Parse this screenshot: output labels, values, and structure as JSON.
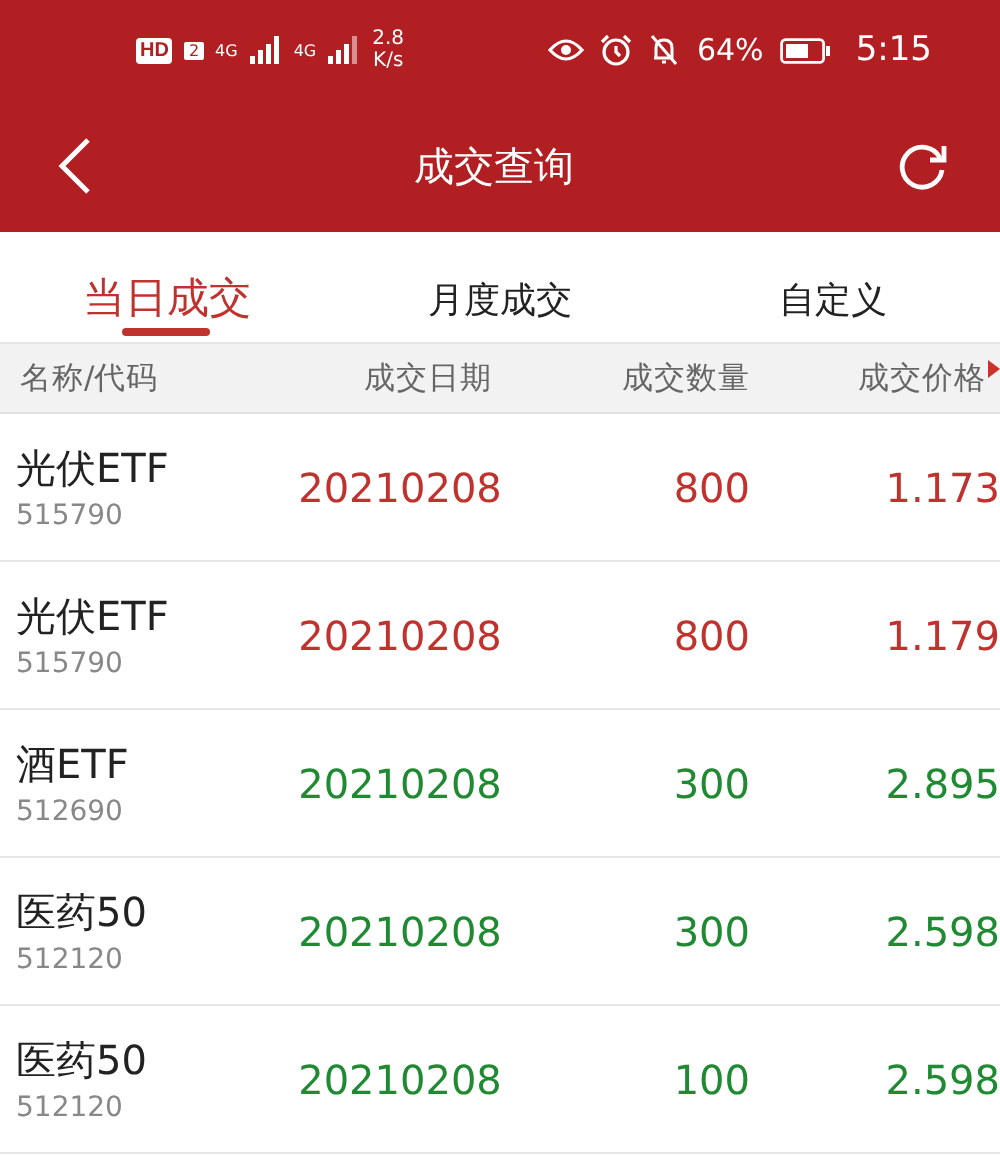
{
  "status_bar": {
    "hd": "HD",
    "speed": "2.8",
    "speed_unit": "K/s",
    "network_1": "4G",
    "network_2": "4G",
    "sim": "2",
    "battery_percent": "64%",
    "time": "5:15"
  },
  "header": {
    "title": "成交查询"
  },
  "tabs": [
    {
      "label": "当日成交",
      "selected": true
    },
    {
      "label": "月度成交",
      "selected": false
    },
    {
      "label": "自定义",
      "selected": false
    }
  ],
  "table": {
    "columns": [
      "名称/代码",
      "成交日期",
      "成交数量",
      "成交价格"
    ],
    "rows": [
      {
        "name": "光伏ETF",
        "code": "515790",
        "date": "20210208",
        "quantity": "800",
        "price": "1.173",
        "color": "#c0322d"
      },
      {
        "name": "光伏ETF",
        "code": "515790",
        "date": "20210208",
        "quantity": "800",
        "price": "1.179",
        "color": "#c0322d"
      },
      {
        "name": "酒ETF",
        "code": "512690",
        "date": "20210208",
        "quantity": "300",
        "price": "2.895",
        "color": "#1f8a32"
      },
      {
        "name": "医药50",
        "code": "512120",
        "date": "20210208",
        "quantity": "300",
        "price": "2.598",
        "color": "#1f8a32"
      },
      {
        "name": "医药50",
        "code": "512120",
        "date": "20210208",
        "quantity": "100",
        "price": "2.598",
        "color": "#1f8a32"
      }
    ]
  }
}
